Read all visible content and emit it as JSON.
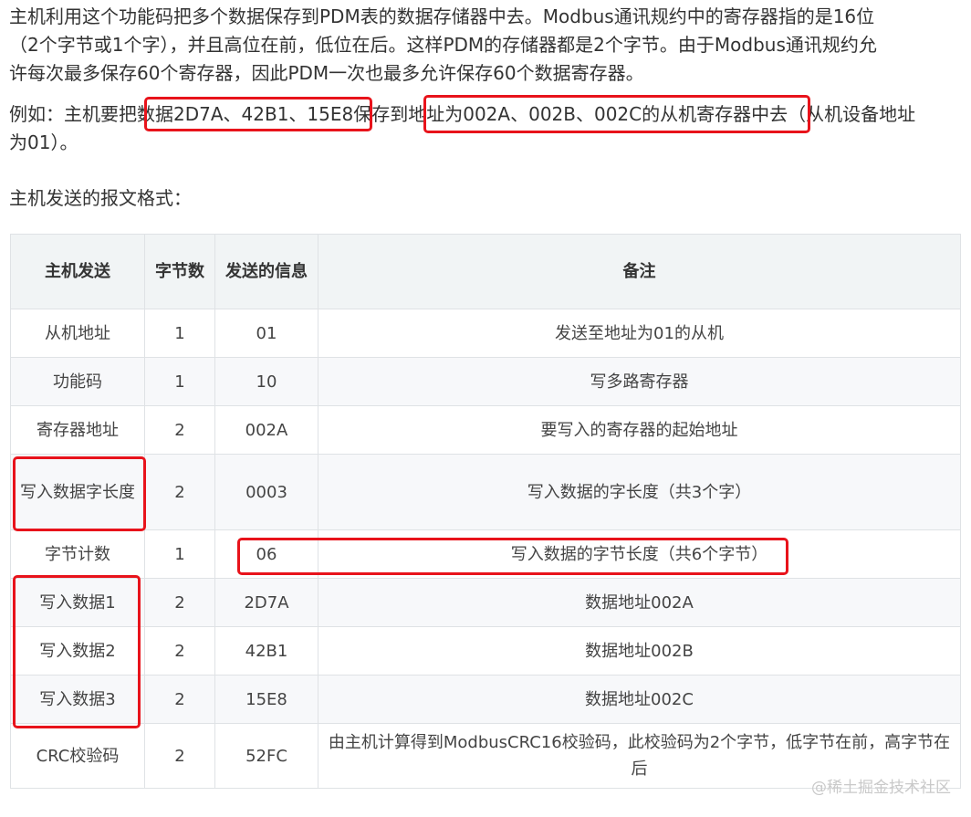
{
  "intro": {
    "line1": "主机利用这个功能码把多个数据保存到PDM表的数据存储器中去。Modbus通讯规约中的寄存器指的是16位",
    "line2": "（2个字节或1个字），并且高位在前，低位在后。这样PDM的存储器都是2个字节。由于Modbus通讯规约允",
    "line3": "许每次最多保存60个寄存器，因此PDM一次也最多允许保存60个数据寄存器。"
  },
  "example": {
    "line1": "例如：主机要把数据2D7A、42B1、15E8保存到地址为002A、002B、002C的从机寄存器中去（从机设备地址",
    "line2": "为01）。"
  },
  "format_label": "主机发送的报文格式：",
  "table": {
    "headers": {
      "col1": "主机发送",
      "col2": "字节数",
      "col3": "发送的信息",
      "col4": "备注"
    },
    "rows": [
      {
        "field": "从机地址",
        "bytes": "1",
        "info": "01",
        "note": "发送至地址为01的从机"
      },
      {
        "field": "功能码",
        "bytes": "1",
        "info": "10",
        "note": "写多路寄存器"
      },
      {
        "field": "寄存器地址",
        "bytes": "2",
        "info": "002A",
        "note": "要写入的寄存器的起始地址"
      },
      {
        "field": "写入数据字长度",
        "bytes": "2",
        "info": "0003",
        "note": "写入数据的字长度（共3个字）"
      },
      {
        "field": "字节计数",
        "bytes": "1",
        "info": "06",
        "note": "写入数据的字节长度（共6个字节）"
      },
      {
        "field": "写入数据1",
        "bytes": "2",
        "info": "2D7A",
        "note": "数据地址002A"
      },
      {
        "field": "写入数据2",
        "bytes": "2",
        "info": "42B1",
        "note": "数据地址002B"
      },
      {
        "field": "写入数据3",
        "bytes": "2",
        "info": "15E8",
        "note": "数据地址002C"
      },
      {
        "field": "CRC校验码",
        "bytes": "2",
        "info": "52FC",
        "note": "由主机计算得到ModbusCRC16校验码，此校验码为2个字节，低字节在前，高字节在后"
      }
    ]
  },
  "watermark": "@稀土掘金技术社区",
  "colors": {
    "highlight_box": "#e8131b",
    "header_bg": "#f1f4f5",
    "stripe_bg": "#f7f8fa",
    "border": "#dfe2e5"
  }
}
